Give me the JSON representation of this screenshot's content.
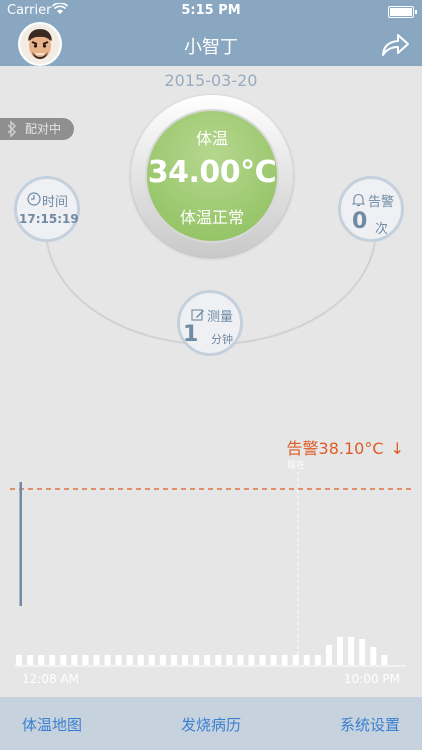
{
  "status": {
    "carrier": "Carrier",
    "time": "5:15 PM"
  },
  "nav": {
    "title": "小智丁"
  },
  "date": "2015-03-20",
  "pairing": {
    "label": "配对中"
  },
  "temperature": {
    "label": "体温",
    "value": "34.00°C",
    "status": "体温正常",
    "color": "#8dbf5c"
  },
  "time_widget": {
    "label": "时间",
    "value": "17:15:19"
  },
  "alarm_widget": {
    "label": "告警",
    "count": "0",
    "unit": "次"
  },
  "measure_widget": {
    "label": "测量",
    "value": "1",
    "unit": "分钟"
  },
  "chart": {
    "alert_label": "告警38.10°C",
    "alert_arrow": "↓",
    "now_label": "现在",
    "x_start": "12:08 AM",
    "x_end": "10:00 PM",
    "alert_color": "#e05b24"
  },
  "chart_data": {
    "type": "bar",
    "threshold": 38.1,
    "bars": [
      0.1,
      0.1,
      0.1,
      0.1,
      0.1,
      0.1,
      0.1,
      0.1,
      0.1,
      0.1,
      0.1,
      0.1,
      0.1,
      0.1,
      0.1,
      0.1,
      0.1,
      0.1,
      0.1,
      0.1,
      0.1,
      0.1,
      0.1,
      0.1,
      0.1,
      0.1,
      0.1,
      0.1,
      0.2,
      0.28,
      0.28,
      0.26,
      0.18,
      0.1
    ]
  },
  "tabs": [
    "体温地图",
    "发烧病历",
    "系统设置"
  ]
}
